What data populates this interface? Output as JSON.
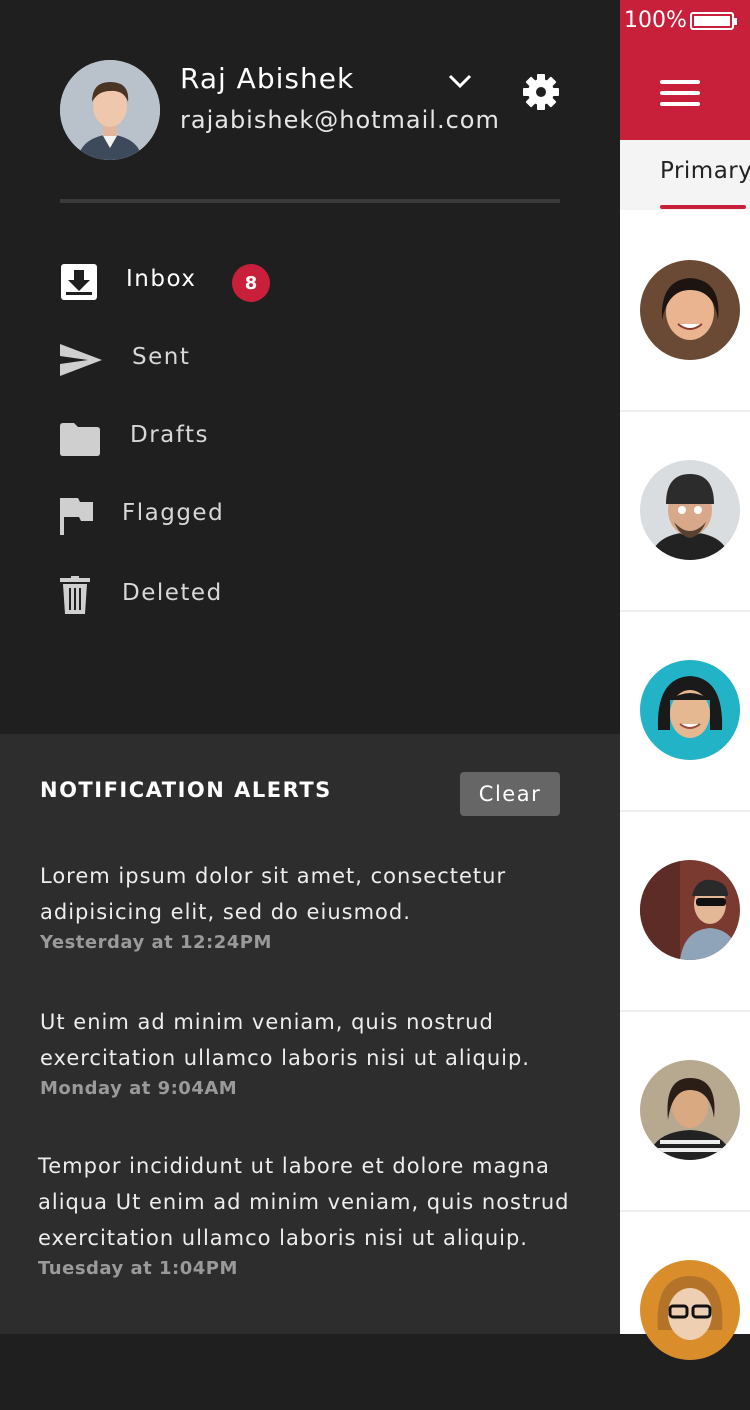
{
  "account": {
    "name": "Raj Abishek",
    "email": "rajabishek@hotmail.com"
  },
  "nav": [
    {
      "label": "Inbox",
      "icon": "inbox-icon",
      "badge": "8"
    },
    {
      "label": "Sent",
      "icon": "send-icon"
    },
    {
      "label": "Drafts",
      "icon": "folder-icon"
    },
    {
      "label": "Flagged",
      "icon": "flag-icon"
    },
    {
      "label": "Deleted",
      "icon": "trash-icon"
    }
  ],
  "notifications": {
    "title": "NOTIFICATION ALERTS",
    "clear_label": "Clear",
    "items": [
      {
        "text": "Lorem ipsum dolor sit amet, consectetur adipisicing elit, sed do eiusmod.",
        "time": "Yesterday at 12:24PM"
      },
      {
        "text": "Ut enim ad minim veniam, quis nostrud exercitation ullamco laboris nisi ut aliquip.",
        "time": "Monday at 9:04AM"
      },
      {
        "text": "Tempor incididunt ut labore et dolore magna aliqua Ut enim ad minim veniam, quis nostrud exercitation ullamco laboris nisi ut aliquip.",
        "time": "Tuesday at 1:04PM"
      }
    ]
  },
  "status": {
    "battery": "100%"
  },
  "tabs": {
    "primary": "Primary"
  },
  "colors": {
    "accent": "#c8203b",
    "drawer_bg": "#1f1f1f",
    "notif_bg": "#2d2d2d"
  }
}
